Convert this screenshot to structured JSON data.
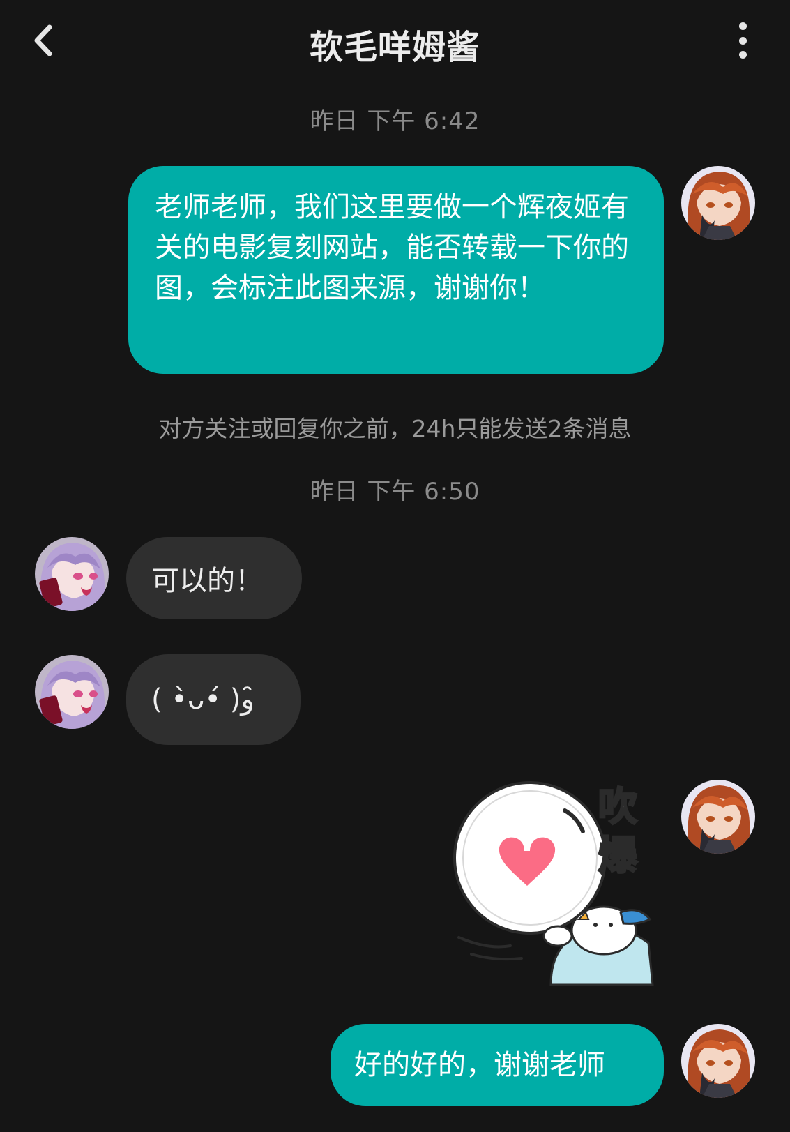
{
  "header": {
    "title": "软毛咩姆酱",
    "back_icon": "chevron-left-icon",
    "more_icon": "more-vertical-icon"
  },
  "messages": {
    "time1": "昨日 下午 6:42",
    "out1": "老师老师，我们这里要做一个辉夜姬有关的电影复刻网站，能否转载一下你的图，会标注此图来源，谢谢你！",
    "notice": "对方关注或回复你之前，24h只能发送2条消息",
    "time2": "昨日 下午 6:50",
    "in1": "可以的！",
    "in2": "( •̀ᴗ•́ )و ̑̑",
    "sticker_text": "吹爆",
    "out2": "好的好的，谢谢老师"
  },
  "colors": {
    "background": "#151515",
    "outgoing_bubble": "#00ada7",
    "incoming_bubble": "#2f2f2f",
    "heart": "#fb6c85"
  }
}
